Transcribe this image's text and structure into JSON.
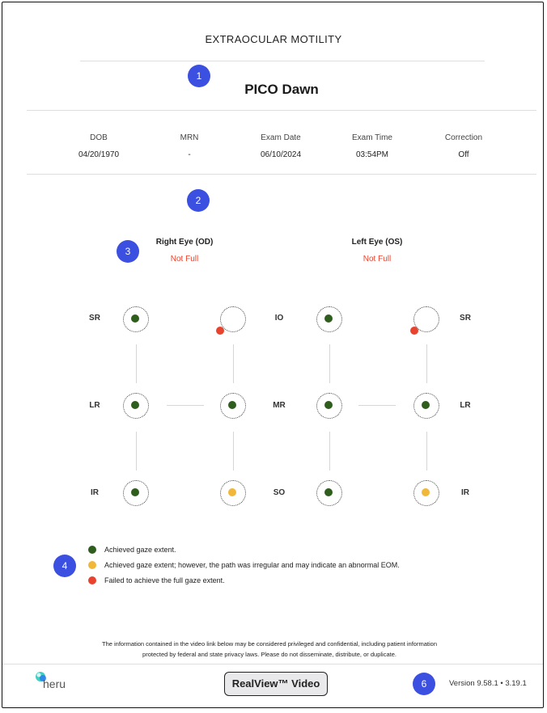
{
  "report": {
    "title": "EXTRAOCULAR MOTILITY",
    "patient_name": "PICO Dawn"
  },
  "info": [
    {
      "label": "DOB",
      "value": "04/20/1970"
    },
    {
      "label": "MRN",
      "value": "-"
    },
    {
      "label": "Exam Date",
      "value": "06/10/2024"
    },
    {
      "label": "Exam Time",
      "value": "03:54PM"
    },
    {
      "label": "Correction",
      "value": "Off"
    }
  ],
  "eyes": {
    "right": {
      "title": "Right Eye (OD)",
      "status": "Not Full"
    },
    "left": {
      "title": "Left Eye (OS)",
      "status": "Not Full"
    }
  },
  "muscle_labels": {
    "left_col": [
      "SR",
      "LR",
      "IR"
    ],
    "middle_col": [
      "IO",
      "MR",
      "SO"
    ],
    "right_col": [
      "SR",
      "LR",
      "IR"
    ]
  },
  "gaze_results": {
    "right_eye": {
      "temporal": [
        "achieved",
        "achieved",
        "achieved"
      ],
      "nasal": [
        "failed",
        "achieved",
        "irregular"
      ]
    },
    "left_eye": {
      "nasal": [
        "achieved",
        "achieved",
        "achieved"
      ],
      "temporal": [
        "failed",
        "achieved",
        "irregular"
      ]
    }
  },
  "legend": [
    {
      "status": "achieved",
      "color": "#2f5d1e",
      "text": "Achieved gaze extent."
    },
    {
      "status": "irregular",
      "color": "#f0b73a",
      "text": "Achieved gaze extent; however, the path was irregular and may indicate an abnormal EOM."
    },
    {
      "status": "failed",
      "color": "#e8432e",
      "text": "Failed to achieve the full gaze extent."
    }
  ],
  "badges": [
    "1",
    "2",
    "3",
    "4",
    "6"
  ],
  "disclaimer": {
    "line1": "The information contained in the video link below may be considered privileged and confidential, including patient information",
    "line2": "protected by federal and state privacy laws. Please do not disseminate, distribute, or duplicate."
  },
  "footer": {
    "logo_text": "heru",
    "button_label": "RealView™ Video",
    "version": "Version 9.58.1 • 3.19.1"
  }
}
